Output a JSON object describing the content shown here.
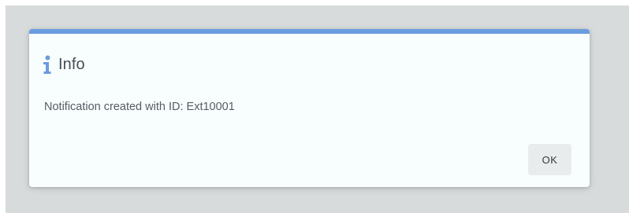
{
  "dialog": {
    "icon": "info-icon",
    "title": "Info",
    "message": "Notification created with ID: Ext10001",
    "ok_label": "OK"
  },
  "colors": {
    "accent": "#6a9ce0",
    "overlay": "#d7dbdb",
    "dialog_background": "#f8fefe",
    "button_background": "#e8ecec"
  }
}
